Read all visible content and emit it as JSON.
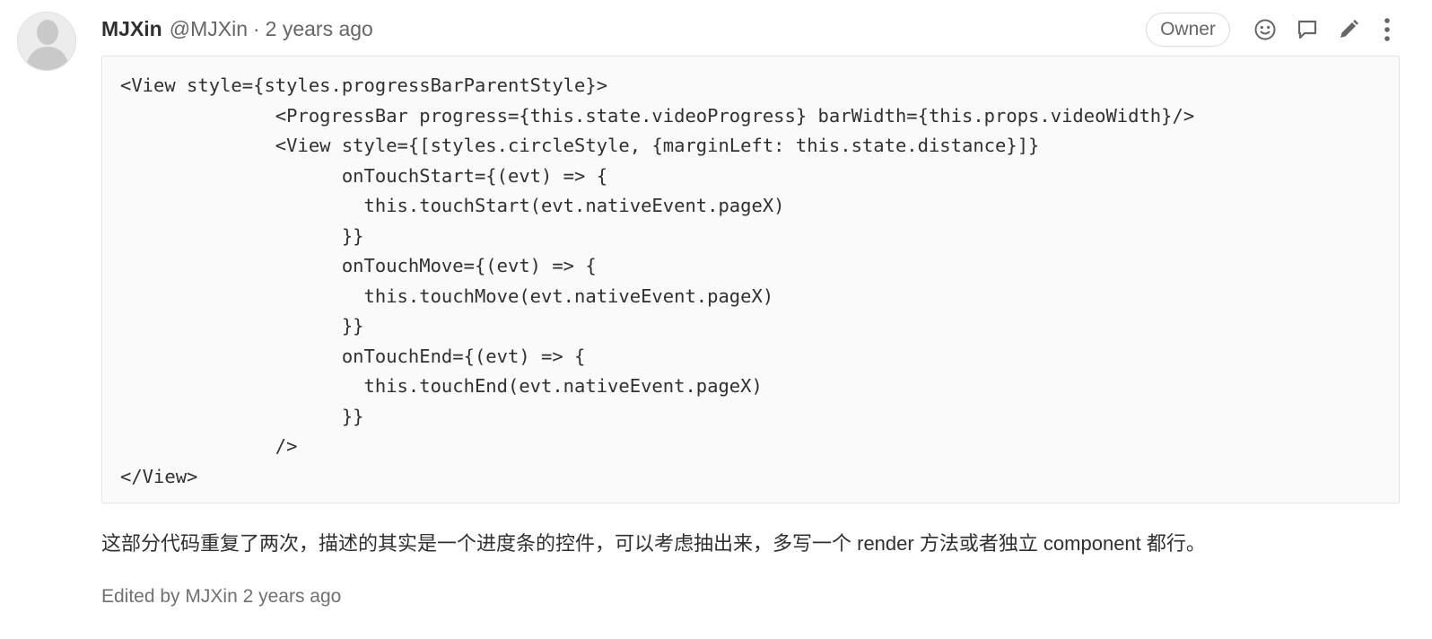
{
  "note": {
    "author_name": "MJXin",
    "author_handle": "@MJXin",
    "separator": "·",
    "time_ago": "2 years ago",
    "badge": "Owner",
    "actions": {
      "emoji_icon": "smiley-icon",
      "reply_icon": "comment-icon",
      "edit_icon": "pencil-icon",
      "more_icon": "kebab-menu-icon"
    },
    "code_lines": [
      "<View style={styles.progressBarParentStyle}>",
      "              <ProgressBar progress={this.state.videoProgress} barWidth={this.props.videoWidth}/>",
      "              <View style={[styles.circleStyle, {marginLeft: this.state.distance}]}",
      "                    onTouchStart={(evt) => {",
      "                      this.touchStart(evt.nativeEvent.pageX)",
      "                    }}",
      "                    onTouchMove={(evt) => {",
      "                      this.touchMove(evt.nativeEvent.pageX)",
      "                    }}",
      "                    onTouchEnd={(evt) => {",
      "                      this.touchEnd(evt.nativeEvent.pageX)",
      "                    }}",
      "              />",
      "</View>"
    ],
    "comment": "这部分代码重复了两次，描述的其实是一个进度条的控件，可以考虑抽出来，多写一个 render 方法或者独立 component 都行。",
    "edited_prefix": "Edited by",
    "edited_by": "MJXin",
    "edited_time": "2 years ago"
  },
  "colors": {
    "text": "#303030",
    "muted": "#666666",
    "border": "#e5e5e5",
    "code_bg": "#fafafa"
  }
}
